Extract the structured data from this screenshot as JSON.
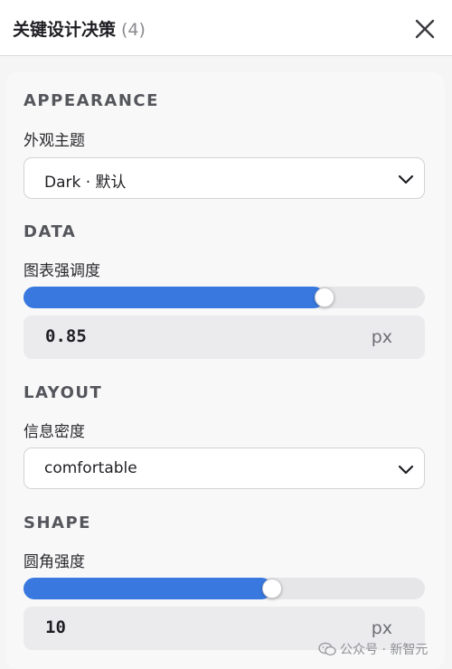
{
  "header": {
    "title": "关键设计决策",
    "count": "(4)",
    "close_icon": "close-icon"
  },
  "sections": {
    "appearance": {
      "title": "APPEARANCE",
      "theme_label": "外观主题",
      "theme_value": "Dark · 默认"
    },
    "data": {
      "title": "DATA",
      "intensity_label": "图表强调度",
      "intensity_fraction": 0.75,
      "intensity_value": "0.85",
      "intensity_unit": "px"
    },
    "layout": {
      "title": "LAYOUT",
      "density_label": "信息密度",
      "density_value": "comfortable"
    },
    "shape": {
      "title": "SHAPE",
      "radius_label": "圆角强度",
      "radius_fraction": 0.62,
      "radius_value": "10",
      "radius_unit": "px"
    }
  },
  "watermark": {
    "text": "公众号 · 新智元",
    "logo_icon": "wechat-logo-icon"
  },
  "colors": {
    "accent": "#3878df",
    "track": "#e6e6e8",
    "input_bg": "#ebebed"
  }
}
